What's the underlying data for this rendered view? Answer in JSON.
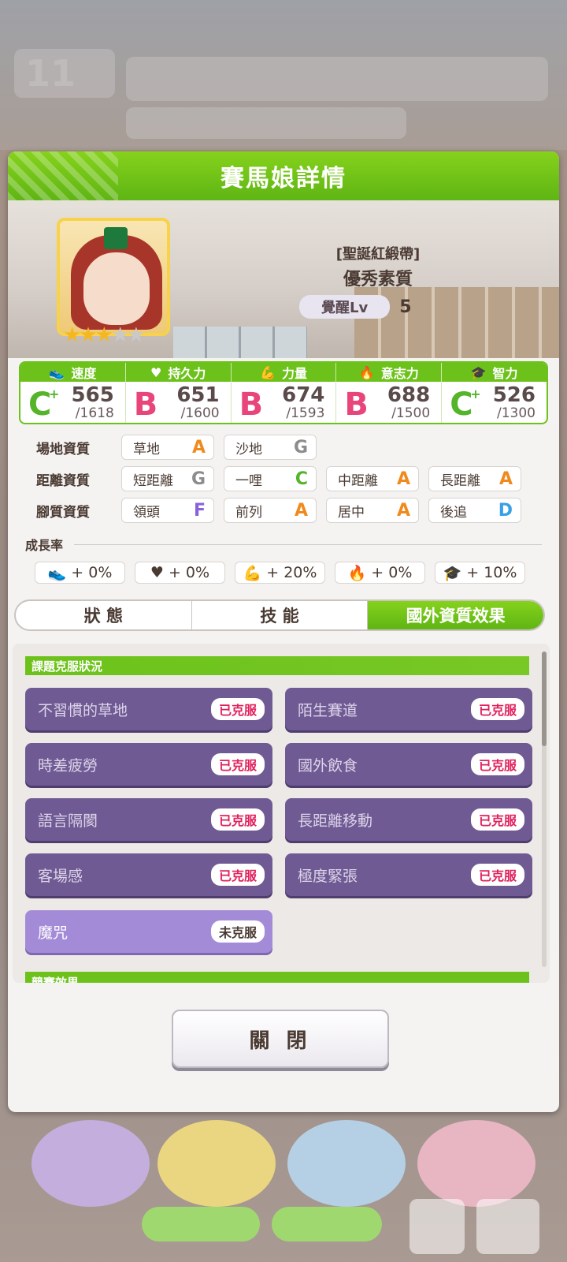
{
  "header": {
    "title": "賽馬娘詳情"
  },
  "card": {
    "epithet": "[聖誕紅緞帶]",
    "title": "優秀素質",
    "awaken_label": "覺醒Lv",
    "awaken_level": "5",
    "stars_filled": 3,
    "stars_total": 5
  },
  "stats": [
    {
      "label": "速度",
      "grade": "C",
      "grade_plus": true,
      "value": "565",
      "max": "/1618",
      "icon": "shoe-icon"
    },
    {
      "label": "持久力",
      "grade": "B",
      "grade_plus": false,
      "value": "651",
      "max": "/1600",
      "icon": "heart-icon"
    },
    {
      "label": "力量",
      "grade": "B",
      "grade_plus": false,
      "value": "674",
      "max": "/1593",
      "icon": "muscle-icon"
    },
    {
      "label": "意志力",
      "grade": "B",
      "grade_plus": false,
      "value": "688",
      "max": "/1500",
      "icon": "flame-icon"
    },
    {
      "label": "智力",
      "grade": "C",
      "grade_plus": true,
      "value": "526",
      "max": "/1300",
      "icon": "graduation-cap-icon"
    }
  ],
  "aptitude": {
    "track": {
      "label": "場地資質",
      "items": [
        {
          "name": "草地",
          "grade": "A"
        },
        {
          "name": "沙地",
          "grade": "G"
        }
      ]
    },
    "distance": {
      "label": "距離資質",
      "items": [
        {
          "name": "短距離",
          "grade": "G"
        },
        {
          "name": "一哩",
          "grade": "C"
        },
        {
          "name": "中距離",
          "grade": "A"
        },
        {
          "name": "長距離",
          "grade": "A"
        }
      ]
    },
    "style": {
      "label": "腳質資質",
      "items": [
        {
          "name": "領頭",
          "grade": "F"
        },
        {
          "name": "前列",
          "grade": "A"
        },
        {
          "name": "居中",
          "grade": "A"
        },
        {
          "name": "後追",
          "grade": "D"
        }
      ]
    }
  },
  "growth": {
    "label": "成長率",
    "items": [
      "+ 0%",
      "+ 0%",
      "+ 20%",
      "+ 0%",
      "+ 10%"
    ]
  },
  "tabs": [
    "狀 態",
    "技 能",
    "國外資質效果"
  ],
  "active_tab": 2,
  "section": {
    "title": "課題克服狀況",
    "next_title": "競賽效果"
  },
  "tasks": [
    {
      "name": "不習慣的草地",
      "status": "已克服"
    },
    {
      "name": "陌生賽道",
      "status": "已克服"
    },
    {
      "name": "時差疲勞",
      "status": "已克服"
    },
    {
      "name": "國外飲食",
      "status": "已克服"
    },
    {
      "name": "語言隔閡",
      "status": "已克服"
    },
    {
      "name": "長距離移動",
      "status": "已克服"
    },
    {
      "name": "客場感",
      "status": "已克服"
    },
    {
      "name": "極度緊張",
      "status": "已克服"
    },
    {
      "name": "魔咒",
      "status": "未克服"
    }
  ],
  "close_label": "關 閉",
  "background": {
    "turn_number": "11"
  },
  "colors": {
    "accent_green": "#6cc21a",
    "task_purple": "#6f5a93",
    "task_open": "#a48bd7",
    "status_red": "#e0205c",
    "grade_A": "#f08a1e",
    "grade_B": "#e8457a",
    "grade_C": "#54b42a",
    "grade_D": "#3aa0e6",
    "grade_F": "#8a62d8",
    "grade_G": "#8c8c8c"
  }
}
